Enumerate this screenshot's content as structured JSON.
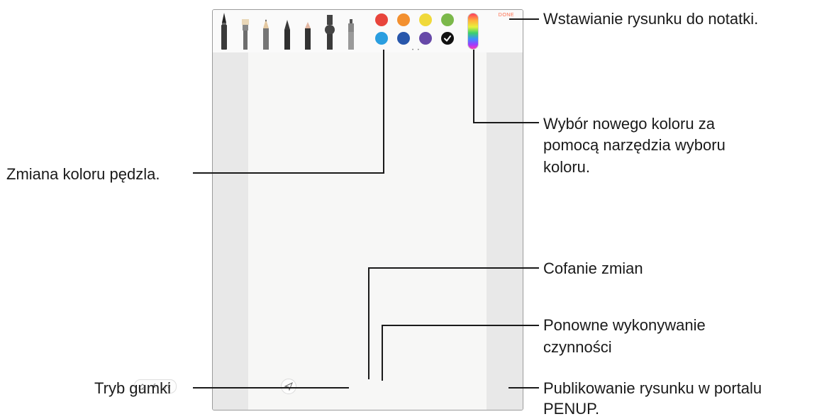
{
  "toolbar": {
    "done_label": "DONE",
    "pen_types": [
      "pen",
      "calligraphy-brush",
      "pencil",
      "fountain-pen",
      "marker",
      "highlighter",
      "spray"
    ],
    "swatches_row1": [
      "#e8453c",
      "#f3902f",
      "#f0d93a",
      "#7bb84a"
    ],
    "swatches_row2": [
      "#2a9ee0",
      "#2857ab",
      "#6749a8",
      "#111111"
    ],
    "selected_swatch": "#111111"
  },
  "callouts": {
    "insert_drawing": "Wstawianie rysunku do notatki.",
    "color_picker_l1": "Wybór nowego koloru za",
    "color_picker_l2": "pomocą narzędzia wyboru",
    "color_picker_l3": "koloru.",
    "change_brush_color": "Zmiana koloru pędzla.",
    "undo": "Cofanie zmian",
    "redo_l1": "Ponowne wykonywanie",
    "redo_l2": "czynności",
    "eraser": "Tryb gumki",
    "publish_l1": "Publikowanie rysunku w portalu",
    "publish_l2": "PENUP."
  },
  "icons": {
    "eraser": "eraser-icon",
    "undo": "undo-icon",
    "redo": "redo-icon",
    "send": "send-icon"
  }
}
